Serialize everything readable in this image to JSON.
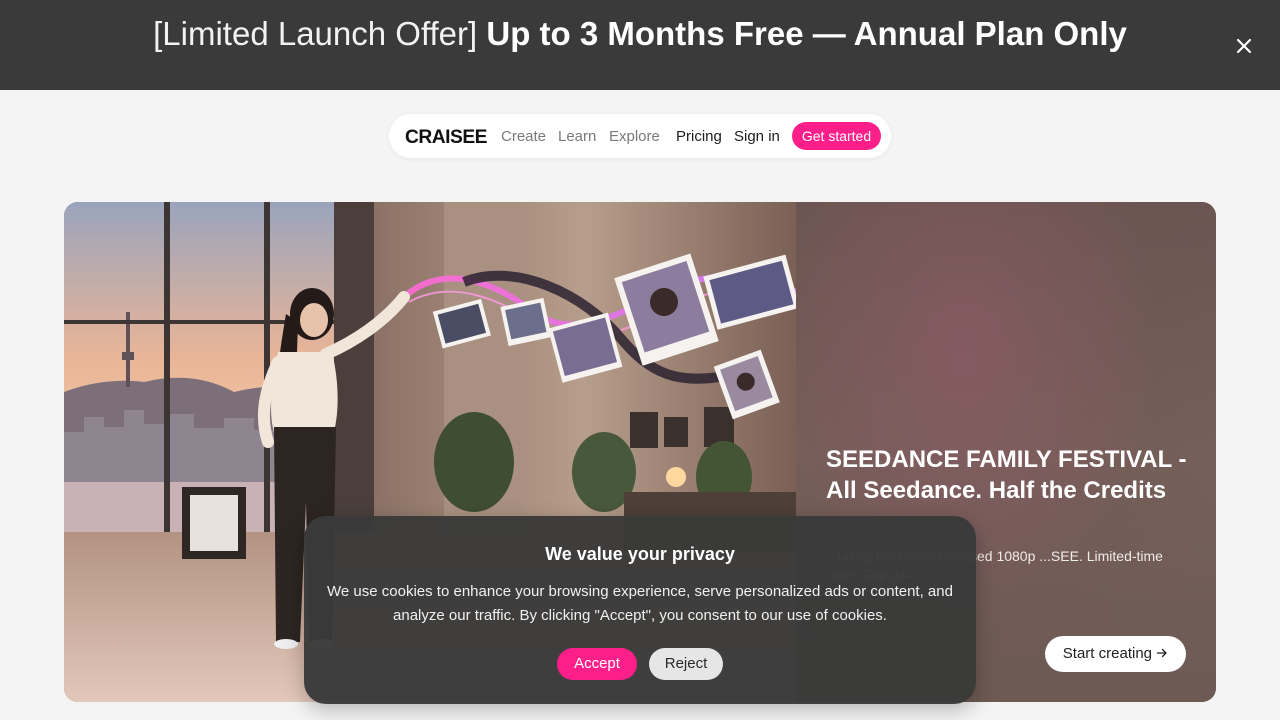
{
  "promo": {
    "prefix": "[Limited Launch Offer]",
    "headline": "Up to 3 Months Free — Annual Plan Only",
    "close_icon": "close-icon"
  },
  "nav": {
    "logo_text": "CRAISEE",
    "links": [
      "Create",
      "Learn",
      "Explore",
      "Pricing",
      "Sign in"
    ],
    "cta": "Get started"
  },
  "hero": {
    "title": "SEEDANCE FAMILY FESTIVAL - All Seedance. Half the Credits",
    "description": "...uding the newly released 1080p ...SEE. Limited-time offer: Sep 24–",
    "button": "Start creating",
    "button_icon": "arrow-right-icon"
  },
  "cookie": {
    "title": "We value your privacy",
    "body": "We use cookies to enhance your browsing experience, serve personalized ads or content, and analyze our traffic. By clicking \"Accept\", you consent to our use of cookies.",
    "accept": "Accept",
    "reject": "Reject"
  },
  "colors": {
    "accent": "#ff1f8a",
    "banner": "#3a3a3a",
    "page_bg": "#f4f4f4"
  }
}
